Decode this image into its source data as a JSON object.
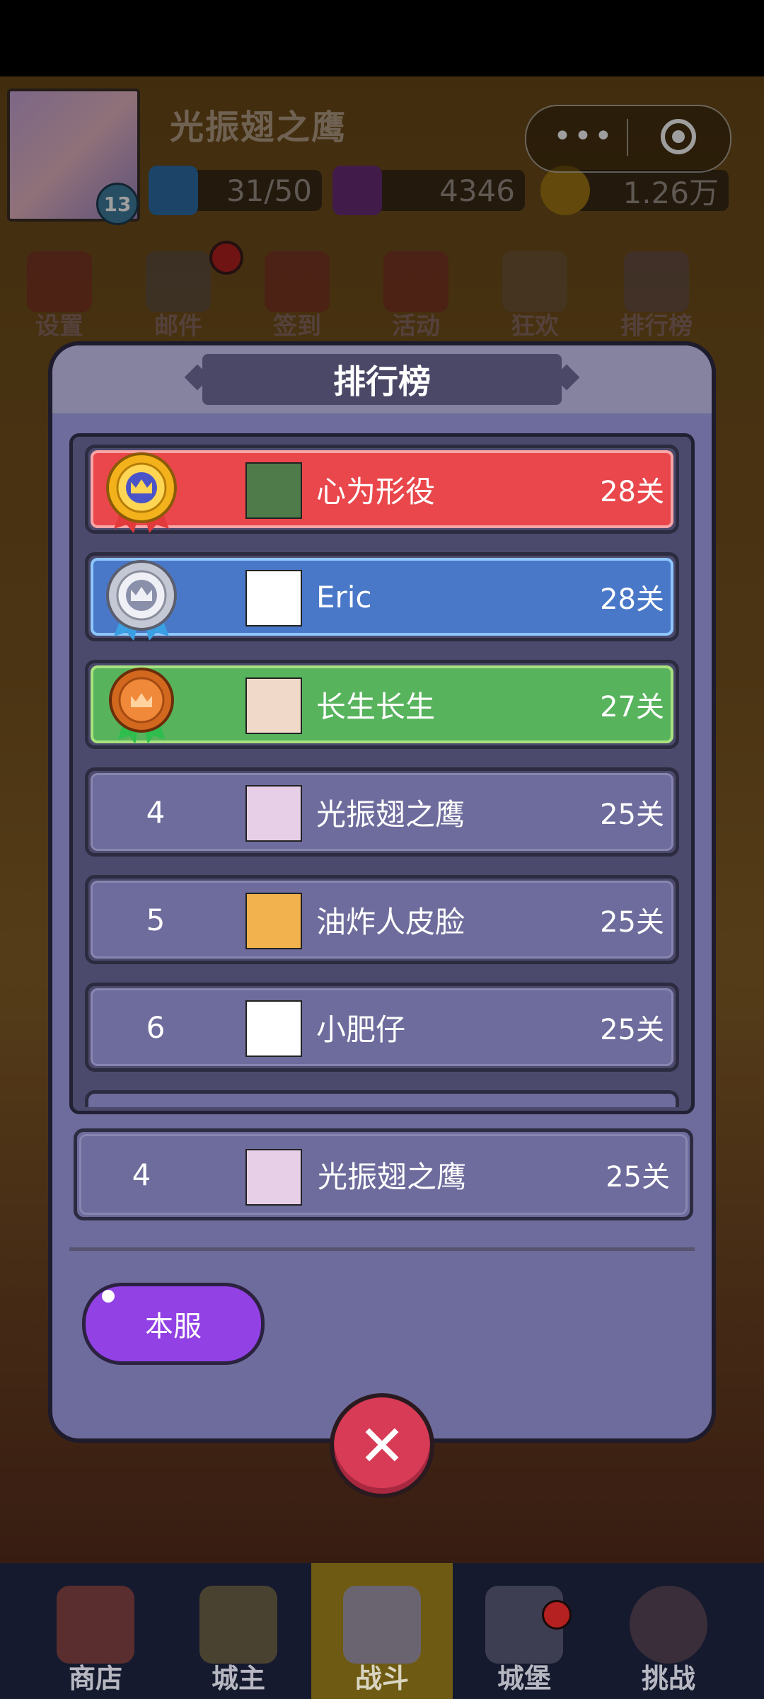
{
  "player": {
    "name": "光振翅之鹰",
    "level": "13"
  },
  "resources": [
    {
      "icon": "energy-icon",
      "value": "31/50"
    },
    {
      "icon": "gem-icon",
      "value": "4346"
    },
    {
      "icon": "coin-icon",
      "value": "1.26万"
    }
  ],
  "capsule": {
    "more_icon": "more-icon",
    "close_icon": "target-icon"
  },
  "menu": [
    {
      "id": "settings",
      "label": "设置",
      "icon": "gear-icon"
    },
    {
      "id": "mail",
      "label": "邮件",
      "icon": "mail-icon"
    },
    {
      "id": "checkin",
      "label": "签到",
      "icon": "calendar-icon"
    },
    {
      "id": "activity",
      "label": "活动",
      "icon": "gift-icon"
    },
    {
      "id": "carnival",
      "label": "狂欢",
      "icon": "balloon-icon"
    },
    {
      "id": "ranking",
      "label": "排行榜",
      "icon": "bar-chart-icon"
    }
  ],
  "modal": {
    "title": "排行榜",
    "rows": [
      {
        "rank": "1",
        "name": "心为形役",
        "score": "28关",
        "style": "gold"
      },
      {
        "rank": "2",
        "name": "Eric",
        "score": "28关",
        "style": "silver"
      },
      {
        "rank": "3",
        "name": "长生长生",
        "score": "27关",
        "style": "bronze"
      },
      {
        "rank": "4",
        "name": "光振翅之鹰",
        "score": "25关",
        "style": "normal"
      },
      {
        "rank": "5",
        "name": "油炸人皮脸",
        "score": "25关",
        "style": "normal"
      },
      {
        "rank": "6",
        "name": "小肥仔",
        "score": "25关",
        "style": "normal"
      }
    ],
    "self_row": {
      "rank": "4",
      "name": "光振翅之鹰",
      "score": "25关"
    },
    "server_button": "本服"
  },
  "colors": {
    "gold_row": "#e9474b",
    "silver_row": "#4a78c8",
    "bronze_row": "#58b35d",
    "normal_row": "#6e6c9c",
    "modal_bg": "#6e6c9c",
    "server_button": "#9141e4",
    "close_button": "#d83b56"
  },
  "bottom_nav": [
    {
      "label": "商店",
      "icon": "shop-icon"
    },
    {
      "label": "城主",
      "icon": "crown-icon"
    },
    {
      "label": "战斗",
      "icon": "crossed-swords-icon",
      "active": true
    },
    {
      "label": "城堡",
      "icon": "castle-icon"
    },
    {
      "label": "挑战",
      "icon": "demon-icon"
    }
  ]
}
